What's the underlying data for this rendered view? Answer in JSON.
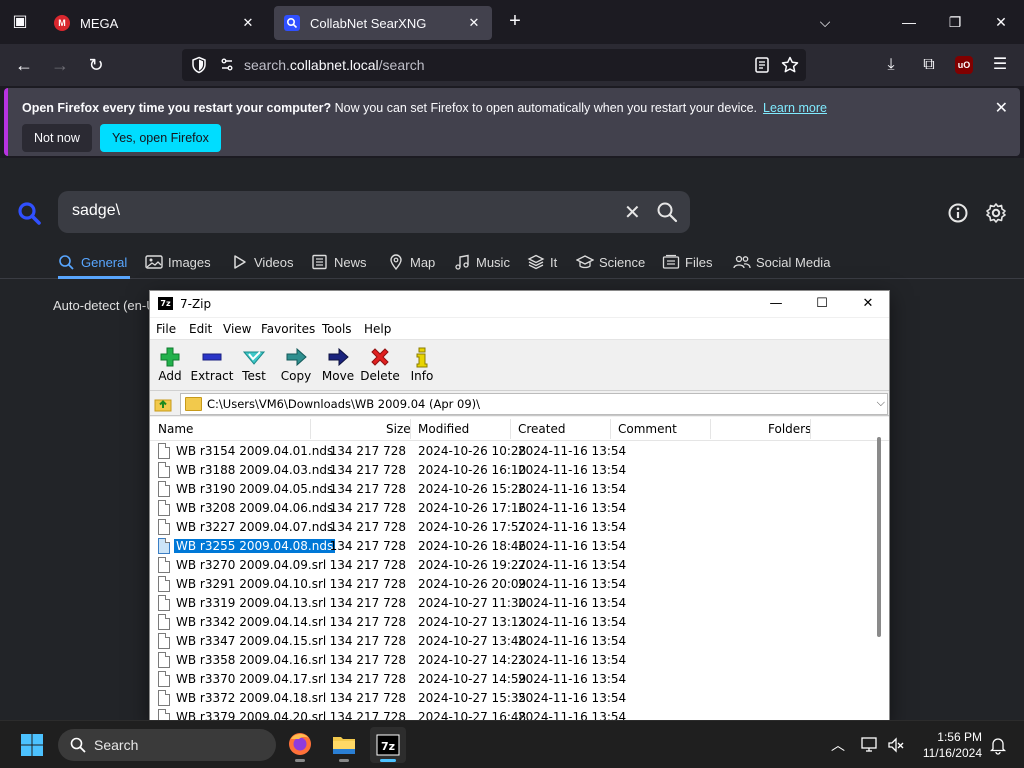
{
  "browser": {
    "tabs": [
      {
        "title": "MEGA",
        "favicon": "mega-icon"
      },
      {
        "title": "CollabNet SearXNG",
        "favicon": "searxng-icon"
      }
    ],
    "url_prefix": "search.",
    "url_host": "collabnet.local",
    "url_path": "/search"
  },
  "notification": {
    "bold": "Open Firefox every time you restart your computer?",
    "text": " Now you can set Firefox to open automatically when you restart your device.",
    "link": "Learn more",
    "not_now": "Not now",
    "yes": "Yes, open Firefox"
  },
  "searx": {
    "query": "sadge\\",
    "categories": [
      "General",
      "Images",
      "Videos",
      "News",
      "Map",
      "Music",
      "It",
      "Science",
      "Files",
      "Social Media"
    ],
    "autodetect": "Auto-detect (en-U"
  },
  "zip": {
    "title": "7-Zip",
    "menu": [
      "File",
      "Edit",
      "View",
      "Favorites",
      "Tools",
      "Help"
    ],
    "toolbar": [
      "Add",
      "Extract",
      "Test",
      "Copy",
      "Move",
      "Delete",
      "Info"
    ],
    "path": "C:\\Users\\VM6\\Downloads\\WB 2009.04 (Apr 09)\\",
    "columns": [
      "Name",
      "Size",
      "Modified",
      "Created",
      "Comment",
      "Folders"
    ],
    "rows": [
      {
        "name": "WB r3154 2009.04.01.nds",
        "size": "134 217 728",
        "modified": "2024-10-26 10:28",
        "created": "2024-11-16 13:54"
      },
      {
        "name": "WB r3188 2009.04.03.nds",
        "size": "134 217 728",
        "modified": "2024-10-26 16:10",
        "created": "2024-11-16 13:54"
      },
      {
        "name": "WB r3190 2009.04.05.nds",
        "size": "134 217 728",
        "modified": "2024-10-26 15:28",
        "created": "2024-11-16 13:54"
      },
      {
        "name": "WB r3208 2009.04.06.nds",
        "size": "134 217 728",
        "modified": "2024-10-26 17:16",
        "created": "2024-11-16 13:54"
      },
      {
        "name": "WB r3227 2009.04.07.nds",
        "size": "134 217 728",
        "modified": "2024-10-26 17:57",
        "created": "2024-11-16 13:54"
      },
      {
        "name": "WB r3255 2009.04.08.nds",
        "size": "134 217 728",
        "modified": "2024-10-26 18:46",
        "created": "2024-11-16 13:54",
        "selected": true
      },
      {
        "name": "WB r3270 2009.04.09.srl",
        "size": "134 217 728",
        "modified": "2024-10-26 19:27",
        "created": "2024-11-16 13:54"
      },
      {
        "name": "WB r3291 2009.04.10.srl",
        "size": "134 217 728",
        "modified": "2024-10-26 20:09",
        "created": "2024-11-16 13:54"
      },
      {
        "name": "WB r3319 2009.04.13.srl",
        "size": "134 217 728",
        "modified": "2024-10-27 11:30",
        "created": "2024-11-16 13:54"
      },
      {
        "name": "WB r3342 2009.04.14.srl",
        "size": "134 217 728",
        "modified": "2024-10-27 13:13",
        "created": "2024-11-16 13:54"
      },
      {
        "name": "WB r3347 2009.04.15.srl",
        "size": "134 217 728",
        "modified": "2024-10-27 13:48",
        "created": "2024-11-16 13:54"
      },
      {
        "name": "WB r3358 2009.04.16.srl",
        "size": "134 217 728",
        "modified": "2024-10-27 14:23",
        "created": "2024-11-16 13:54"
      },
      {
        "name": "WB r3370 2009.04.17.srl",
        "size": "134 217 728",
        "modified": "2024-10-27 14:59",
        "created": "2024-11-16 13:54"
      },
      {
        "name": "WB r3372 2009.04.18.srl",
        "size": "134 217 728",
        "modified": "2024-10-27 15:35",
        "created": "2024-11-16 13:54"
      },
      {
        "name": "WB r3379 2009.04.20.srl",
        "size": "134 217 728",
        "modified": "2024-10-27 16:48",
        "created": "2024-11-16 13:54"
      }
    ]
  },
  "taskbar": {
    "search": "Search",
    "time": "1:56 PM",
    "date": "11/16/2024",
    "apps": [
      "firefox-icon",
      "file-explorer-icon",
      "7zip-icon"
    ]
  },
  "colors": {
    "accent": "#58a6ff",
    "selection": "#0078d7",
    "firefox_cta": "#00ddff"
  }
}
